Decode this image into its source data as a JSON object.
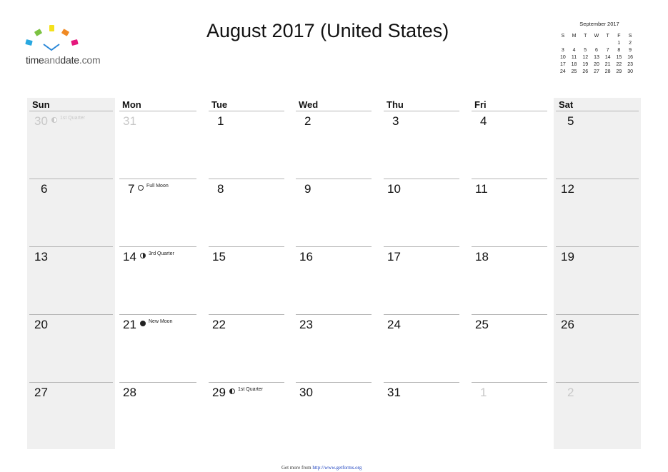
{
  "logo": {
    "text_part1": "time",
    "text_part2": "and",
    "text_part3": "date",
    "text_part4": ".com",
    "colors": [
      "#29a8e0",
      "#7cc242",
      "#f4e11c",
      "#f08a24",
      "#e5177d",
      "#2b88d8"
    ]
  },
  "header": {
    "title": "August 2017 (United States)"
  },
  "mini_calendar": {
    "title": "September 2017",
    "weekdays": [
      "S",
      "M",
      "T",
      "W",
      "T",
      "F",
      "S"
    ],
    "weeks": [
      [
        "",
        "",
        "",
        "",
        "",
        "1",
        "2"
      ],
      [
        "3",
        "4",
        "5",
        "6",
        "7",
        "8",
        "9"
      ],
      [
        "10",
        "11",
        "12",
        "13",
        "14",
        "15",
        "16"
      ],
      [
        "17",
        "18",
        "19",
        "20",
        "21",
        "22",
        "23"
      ],
      [
        "24",
        "25",
        "26",
        "27",
        "28",
        "29",
        "30"
      ]
    ]
  },
  "calendar": {
    "weekdays": [
      "Sun",
      "Mon",
      "Tue",
      "Wed",
      "Thu",
      "Fri",
      "Sat"
    ],
    "weeks": [
      [
        {
          "day": "30",
          "out": true,
          "moon": "first",
          "moon_label": "1st Quarter"
        },
        {
          "day": "31",
          "out": true
        },
        {
          "day": "1"
        },
        {
          "day": "2"
        },
        {
          "day": "3"
        },
        {
          "day": "4"
        },
        {
          "day": "5"
        }
      ],
      [
        {
          "day": "6"
        },
        {
          "day": "7",
          "moon": "full",
          "moon_label": "Full Moon"
        },
        {
          "day": "8"
        },
        {
          "day": "9"
        },
        {
          "day": "10"
        },
        {
          "day": "11"
        },
        {
          "day": "12"
        }
      ],
      [
        {
          "day": "13"
        },
        {
          "day": "14",
          "moon": "third",
          "moon_label": "3rd Quarter"
        },
        {
          "day": "15"
        },
        {
          "day": "16"
        },
        {
          "day": "17"
        },
        {
          "day": "18"
        },
        {
          "day": "19"
        }
      ],
      [
        {
          "day": "20"
        },
        {
          "day": "21",
          "moon": "new",
          "moon_label": "New Moon"
        },
        {
          "day": "22"
        },
        {
          "day": "23"
        },
        {
          "day": "24"
        },
        {
          "day": "25"
        },
        {
          "day": "26"
        }
      ],
      [
        {
          "day": "27"
        },
        {
          "day": "28"
        },
        {
          "day": "29",
          "moon": "first",
          "moon_label": "1st Quarter"
        },
        {
          "day": "30"
        },
        {
          "day": "31"
        },
        {
          "day": "1",
          "out": true
        },
        {
          "day": "2",
          "out": true
        }
      ]
    ]
  },
  "footer": {
    "prefix": "Get more from ",
    "link_text": "http://www.getforms.org"
  }
}
